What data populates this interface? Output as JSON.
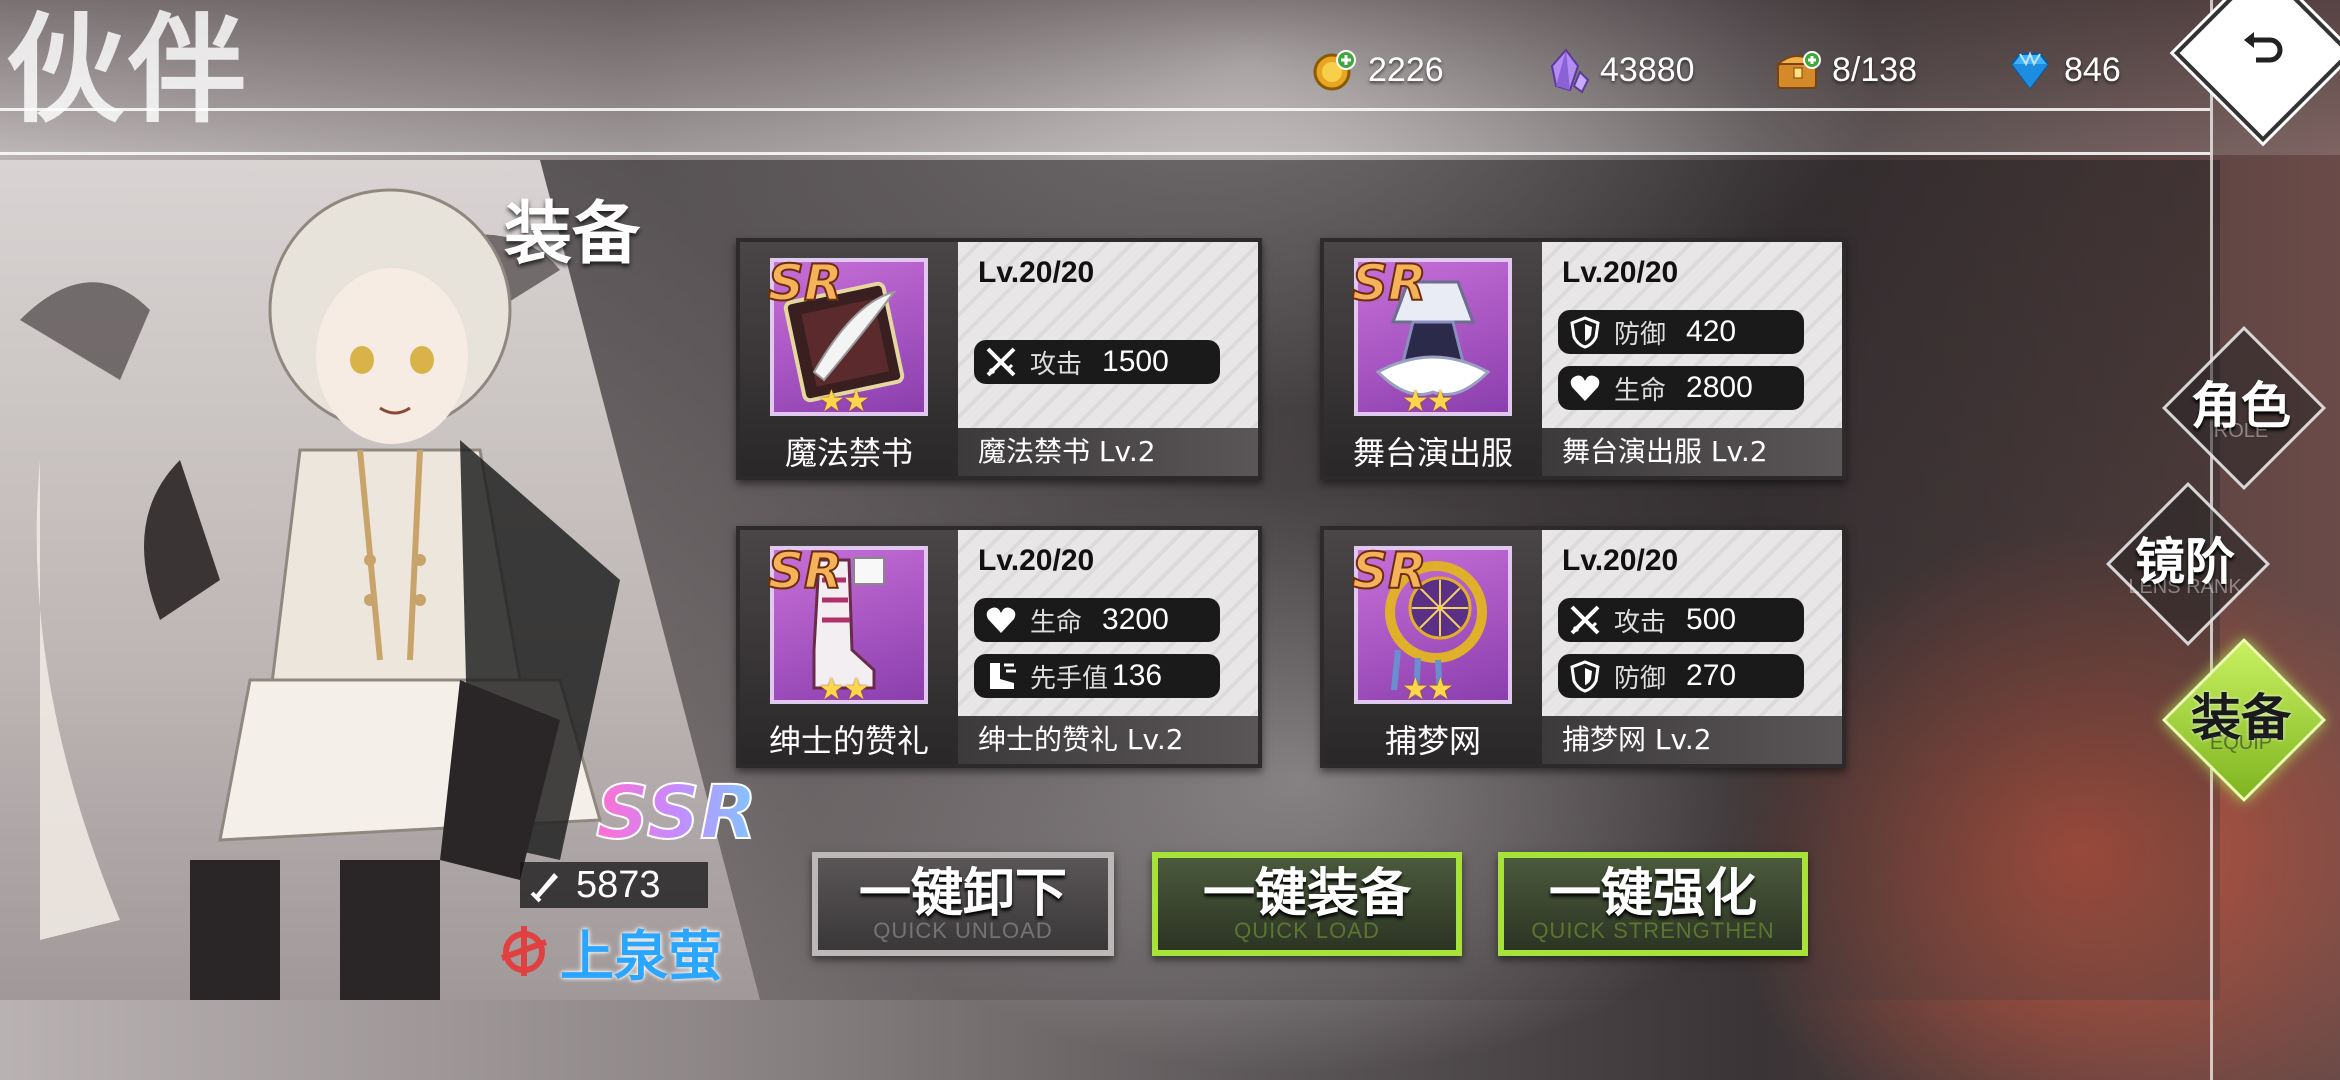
{
  "header": {
    "title": "伙伴",
    "resources": [
      {
        "icon": "gold-coin-icon",
        "value": "2226"
      },
      {
        "icon": "purple-crystal-icon",
        "value": "43880"
      },
      {
        "icon": "treasure-chest-icon",
        "value": "8/138"
      },
      {
        "icon": "blue-diamond-icon",
        "value": "846"
      }
    ]
  },
  "character": {
    "rarity": "SSR",
    "power": "5873",
    "name": "上泉萤"
  },
  "section_title": "装备",
  "equipment": [
    {
      "rarity": "SR",
      "stars": "★★",
      "name": "魔法禁书",
      "level": "Lv.20/20",
      "subname": "魔法禁书 Lv.2",
      "stats": [
        {
          "icon": "sword-icon",
          "label": "攻击",
          "value": "1500"
        }
      ]
    },
    {
      "rarity": "SR",
      "stars": "★★",
      "name": "舞台演出服",
      "level": "Lv.20/20",
      "subname": "舞台演出服 Lv.2",
      "stats": [
        {
          "icon": "shield-icon",
          "label": "防御",
          "value": "420"
        },
        {
          "icon": "heart-icon",
          "label": "生命",
          "value": "2800"
        }
      ]
    },
    {
      "rarity": "SR",
      "stars": "★★",
      "name": "绅士的赞礼",
      "level": "Lv.20/20",
      "subname": "绅士的赞礼 Lv.2",
      "stats": [
        {
          "icon": "heart-icon",
          "label": "生命",
          "value": "3200"
        },
        {
          "icon": "speed-boot-icon",
          "label": "先手值",
          "value": "136"
        }
      ]
    },
    {
      "rarity": "SR",
      "stars": "★★",
      "name": "捕梦网",
      "level": "Lv.20/20",
      "subname": "捕梦网 Lv.2",
      "stats": [
        {
          "icon": "sword-icon",
          "label": "攻击",
          "value": "500"
        },
        {
          "icon": "shield-icon",
          "label": "防御",
          "value": "270"
        }
      ]
    }
  ],
  "buttons": {
    "unload": {
      "label": "一键卸下",
      "en": "QUICK UNLOAD"
    },
    "load": {
      "label": "一键装备",
      "en": "QUICK LOAD"
    },
    "strengthen": {
      "label": "一键强化",
      "en": "QUICK STRENGTHEN"
    }
  },
  "nav": [
    {
      "label": "角色",
      "en": "ROLE",
      "active": false
    },
    {
      "label": "镜阶",
      "en": "LENS RANK",
      "active": false
    },
    {
      "label": "装备",
      "en": "EQUIP",
      "active": true
    }
  ],
  "colors": {
    "accent_green": "#a6e23a",
    "name_blue": "#2aa6ff",
    "sr_orange": "#f6b25a"
  }
}
